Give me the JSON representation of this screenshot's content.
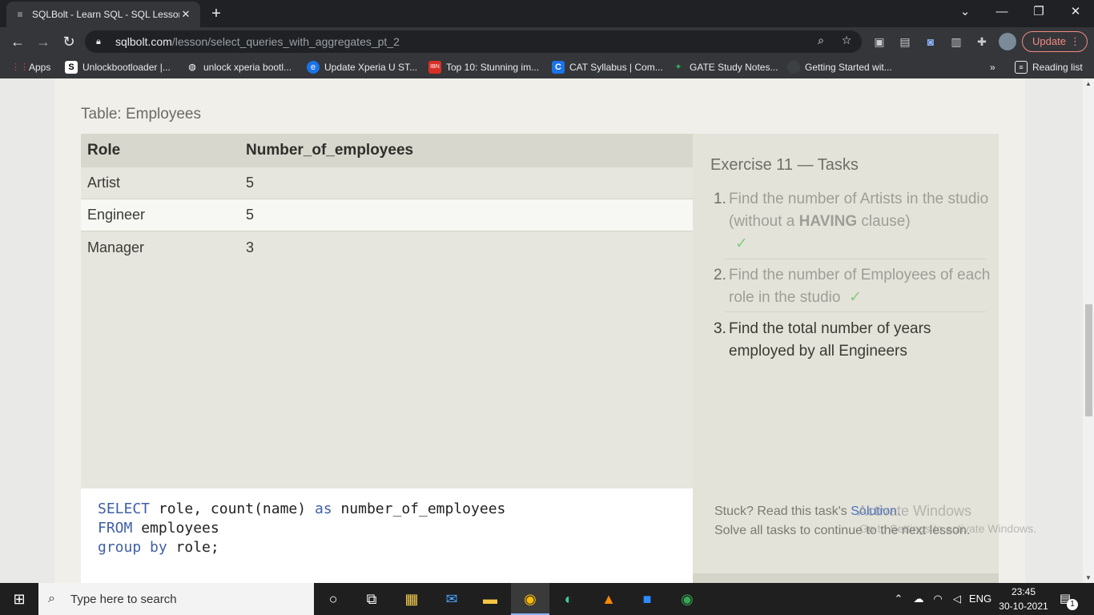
{
  "browser": {
    "tab_title": "SQLBolt - Learn SQL - SQL Lesson",
    "tab_close": "✕",
    "new_tab": "+",
    "url_host": "sqlbolt.com",
    "url_path": "/lesson/select_queries_with_aggregates_pt_2",
    "update_label": "Update",
    "bookmarks": [
      {
        "label": "Apps",
        "icon": "apps-grid-icon",
        "color": "#ea4335"
      },
      {
        "label": "Unlockbootloader |...",
        "icon": "s-logo-icon",
        "color": "#ffffff"
      },
      {
        "label": "unlock xperia bootl...",
        "icon": "globe-icon",
        "color": "#ffffff"
      },
      {
        "label": "Update Xperia U ST...",
        "icon": "globe-icon",
        "color": "#1a73e8"
      },
      {
        "label": "Top 10: Stunning im...",
        "icon": "ibn-logo-icon",
        "color": "#d93025"
      },
      {
        "label": "CAT Syllabus | Com...",
        "icon": "c-logo-icon",
        "color": "#1a73e8"
      },
      {
        "label": "GATE Study Notes...",
        "icon": "leaf-icon",
        "color": "#34a853"
      },
      {
        "label": "Getting Started wit...",
        "icon": "globe-icon",
        "color": "#3c4043"
      }
    ],
    "bookmarks_more": "»",
    "reading_list": "Reading list"
  },
  "lesson": {
    "table_caption": "Table: Employees",
    "columns": [
      "Role",
      "Number_of_employees"
    ],
    "rows": [
      [
        "Artist",
        "5"
      ],
      [
        "Engineer",
        "5"
      ],
      [
        "Manager",
        "3"
      ]
    ],
    "query": {
      "line1_kw1": "SELECT",
      "line1_rest1": " role, count(name) ",
      "line1_kw2": "as",
      "line1_rest2": " number_of_employees",
      "line2_kw": "FROM",
      "line2_rest": " employees",
      "line3_kw": "group by",
      "line3_rest": " role;"
    }
  },
  "tasks": {
    "title": "Exercise 11 — Tasks",
    "items": [
      {
        "num": "1.",
        "text_a": "Find the number of Artists in the studio (without a ",
        "bold": "HAVING",
        "text_b": " clause)",
        "check": "✓",
        "done": true
      },
      {
        "num": "2.",
        "text_a": "Find the number of Employees of each role in the studio",
        "check": "✓",
        "done": true
      },
      {
        "num": "3.",
        "text_a": "Find the total number of years employed by all Engineers",
        "done": false
      }
    ],
    "stuck_prefix": "Stuck? Read this task's ",
    "solution_link": "Solution",
    "stuck_suffix": ".",
    "solve_all": "Solve all tasks to continue to the next lesson."
  },
  "watermark": {
    "line1": "Activate Windows",
    "line2": "Go to Settings to activate Windows."
  },
  "taskbar": {
    "search_placeholder": "Type here to search",
    "language": "ENG",
    "time": "23:45",
    "date": "30-10-2021",
    "notifications": "1"
  }
}
